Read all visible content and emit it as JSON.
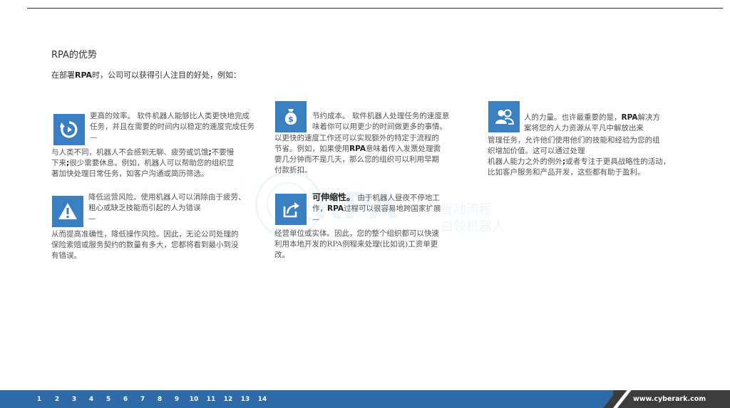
{
  "header": {
    "title": "RPA的优势",
    "intro_pre": "在部署",
    "intro_bold": "RPA",
    "intro_post": "时，公司可以获得引人注目的好处，例如："
  },
  "watermark": {
    "big": "RPA",
    "line1": "智动流程",
    "line2": "白领机器人"
  },
  "blocks": {
    "efficiency": {
      "icon": "speed-refresh-icon",
      "l1": "更高的效率。 软件机器人能够比人类更快地完成",
      "l2": "任务，并且在需要的时间内以稳定的速度完成任务",
      "dash": "—",
      "l3a": "与人类不同，机器人不会感到无聊、疲劳或饥饿",
      "l3b": ";",
      "l3c": "不要慢",
      "l4a": "下来",
      "l4b": ";",
      "l4c": "很少需要休息。例如，机器人可以帮助您的组织显",
      "l5": "著加快处理日常任务，如客户沟通或简历筛选。"
    },
    "cost": {
      "icon": "money-bag-icon",
      "l1": "节约成本。 软件机器人处理任务的速度意",
      "l2": "味着你可以用更少的时间做更多的事情。",
      "l3": "以更快的速度工作还可以实现额外的特定于流程的",
      "l4": "节省。例如，如果使用",
      "l4b": "RPA",
      "l4c": "意味着传入发票处理需",
      "l5": "要几分钟而不是几天，那么您的组织可以利用早期",
      "l6": "付款折扣。"
    },
    "people": {
      "icon": "people-icon",
      "l1a": "人的力量。也许最重要的是，",
      "l1b": "RPA",
      "l1c": "解决方",
      "l2": "案将您的人力资源从平凡中解放出来",
      "l3": "管理任务，允许他们使用他们的技能和经验为您的组",
      "l4": "织增加价值。这可以通过处理",
      "l5a": "机器人能力之外的例外",
      "l5b": ";",
      "l5c": "或者专注于更具战略性的活动，",
      "l6": "比如客户服务和产品开发，这些都有助于盈利。"
    },
    "risk": {
      "icon": "warning-icon",
      "l1": "降低运营风险。使用机器人可以消除由于疲劳、",
      "l2": "粗心或缺乏技能而引起的人为错误",
      "dash": "—",
      "l3": "从而提高准确性，降低操作风险。因此，无论公司处理的",
      "l4": "保险索赔或服务契约的数量有多大，您都将看到最小到没",
      "l5": "有错误。"
    },
    "scalability": {
      "icon": "share-arrow-icon",
      "l1a": "可伸缩性。",
      "l1b": " 由于机器人昼夜不停地工",
      "l2a": "作，",
      "l2b": "RPA",
      "l2c": "过程可以很容易地跨国家扩展",
      "dash": "—",
      "l3": "经营单位或实体。因此，您的整个组织都可以快速",
      "l4": "利用本地开发的RPA例程来处理(比如说)工资单更",
      "l5": "改。"
    }
  },
  "footer": {
    "pages": [
      "1",
      "2",
      "3",
      "4",
      "5",
      "6",
      "7",
      "8",
      "9",
      "10",
      "11",
      "12",
      "13",
      "14"
    ],
    "site": "www.cyberark.com"
  },
  "colors": {
    "accent": "#3a7fc1",
    "footer_blue": "#2f6aa8",
    "footer_dark": "#3c3c3c"
  }
}
